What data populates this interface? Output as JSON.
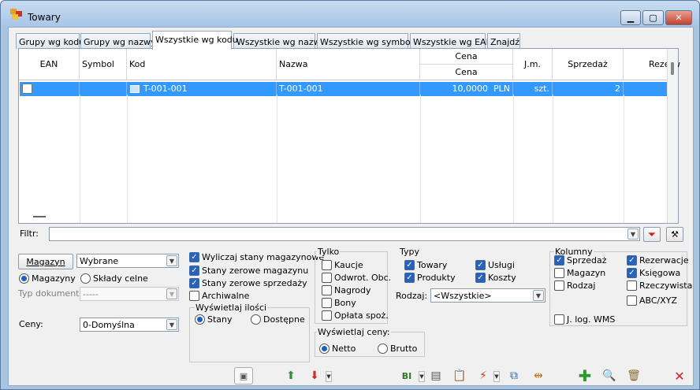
{
  "window": {
    "title": "Towary"
  },
  "tabs": [
    "Grupy wg kodu",
    "Grupy wg nazwy",
    "Wszystkie wg kodu",
    "Wszystkie wg nazwy",
    "Wszystkie wg symbolu",
    "Wszystkie wg EAN",
    "Znajdź"
  ],
  "active_tab": 2,
  "grid": {
    "columns": {
      "ean": "EAN",
      "symbol": "Symbol",
      "kod": "Kod",
      "nazwa": "Nazwa",
      "cena_group": "Cena",
      "cena": "Cena",
      "jm": "J.m.",
      "sprzedaz": "Sprzedaż",
      "rezerw": "Rezerw"
    },
    "rows": [
      {
        "ean": "",
        "symbol": "",
        "kod": "T-001-001",
        "nazwa": "T-001-001",
        "cena": "10,0000",
        "waluta": "PLN",
        "jm": "szt.",
        "sprzedaz": "2"
      }
    ]
  },
  "filter": {
    "label": "Filtr:",
    "value": ""
  },
  "magazyn": {
    "button": "Magazyn",
    "selected": "Wybrane",
    "radio_magazyny": "Magazyny",
    "radio_sklady": "Składy celne",
    "typ_label": "Typ dokumentu:",
    "typ_value": "-----"
  },
  "ceny": {
    "label": "Ceny:",
    "value": "0-Domyślna"
  },
  "stany": {
    "wyliczaj": "Wyliczaj stany magazynowe",
    "zerowe_mag": "Stany zerowe magazynu",
    "zerowe_sprz": "Stany zerowe sprzedaży",
    "archiwalne": "Archiwalne"
  },
  "wyswietlaj_ilosci": {
    "title": "Wyświetlaj ilości",
    "stany": "Stany",
    "dostepne": "Dostępne"
  },
  "tylko": {
    "title": "Tylko",
    "items": [
      "Kaucje",
      "Odwrot. Obc.",
      "Nagrody",
      "Bony",
      "Opłata spoż."
    ]
  },
  "typy": {
    "title": "Typy",
    "towary": "Towary",
    "uslugi": "Usługi",
    "produkty": "Produkty",
    "koszty": "Koszty",
    "rodzaj_label": "Rodzaj:",
    "rodzaj_value": "<Wszystkie>"
  },
  "wyswietlaj_ceny": {
    "title": "Wyświetlaj ceny:",
    "netto": "Netto",
    "brutto": "Brutto"
  },
  "kolumny": {
    "title": "Kolumny",
    "sprzedaz": "Sprzedaż",
    "rezerwacje": "Rezerwacje",
    "magazyn": "Magazyn",
    "ksiegowa": "Księgowa",
    "rodzaj": "Rodzaj",
    "rzeczywista": "Rzeczywista",
    "abc": "ABC/XYZ",
    "jlog": "J. log. WMS"
  },
  "toolbar": {
    "bi": "BI"
  }
}
